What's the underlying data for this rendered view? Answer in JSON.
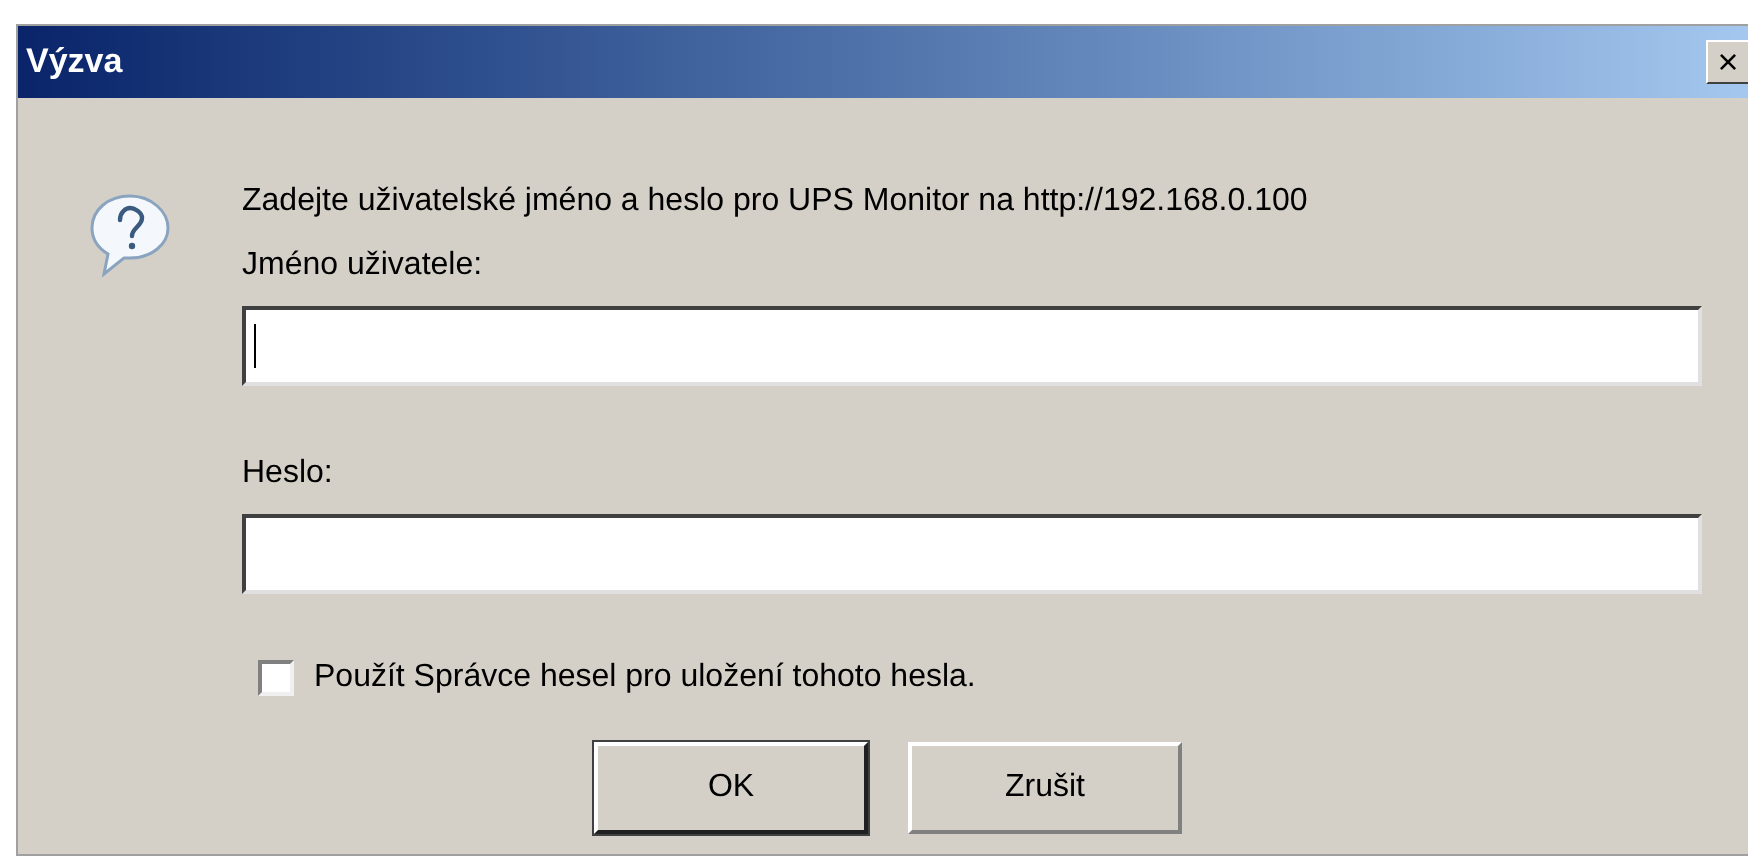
{
  "window": {
    "title": "Výzva",
    "close": "×"
  },
  "message": "Zadejte uživatelské jméno a heslo pro UPS Monitor na http://192.168.0.100",
  "fields": [
    {
      "label": "Jméno uživatele:",
      "focused": true
    },
    {
      "label": "Heslo:",
      "focused": false
    }
  ],
  "checkbox": {
    "label": "Použít Správce hesel pro uložení tohoto hesla.",
    "checked": false
  },
  "buttons": [
    {
      "label": "OK",
      "default": true
    },
    {
      "label": "Zrušit",
      "default": false
    }
  ]
}
